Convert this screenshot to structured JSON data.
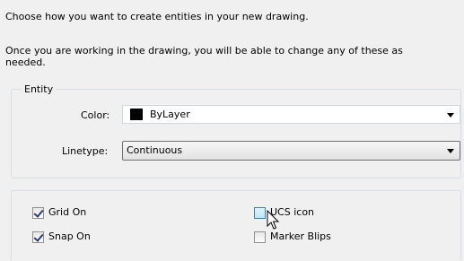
{
  "intro": {
    "line1": "Choose how you want to create entities in your new drawing.",
    "line2": "Once you are working in the drawing, you will be able to change any of these as needed."
  },
  "entity": {
    "group_label": "Entity",
    "color_label": "Color:",
    "color_value": "ByLayer",
    "color_swatch": "#000000",
    "linetype_label": "Linetype:",
    "linetype_value": "Continuous"
  },
  "options": {
    "grid_on": {
      "label": "Grid On",
      "checked": true
    },
    "snap_on": {
      "label": "Snap On",
      "checked": true
    },
    "ucs_icon": {
      "label": "UCS icon",
      "checked": false
    },
    "marker_blips": {
      "label": "Marker Blips",
      "checked": false
    }
  }
}
